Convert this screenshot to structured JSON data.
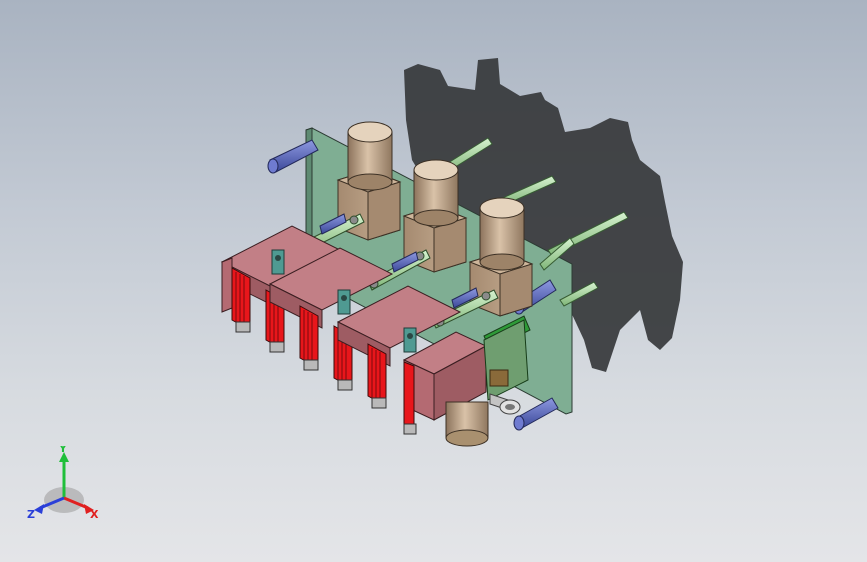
{
  "viewport": {
    "background_top": "#a9b3c1",
    "background_bottom": "#e4e5e8"
  },
  "model": {
    "colors": {
      "plate": "#7fae93",
      "pcb": "#2f9a38",
      "bracket": "#b96d74",
      "coil": "#e8161b",
      "knob": "#b8a088",
      "rod_blue": "#5562b7",
      "rod_green": "#a8d6a0",
      "shadow": "#3b3d40"
    }
  },
  "triad": {
    "x_label": "X",
    "y_label": "Y",
    "z_label": "Z",
    "x_color": "#e02020",
    "y_color": "#1fbf3a",
    "z_color": "#2a3fd8"
  }
}
